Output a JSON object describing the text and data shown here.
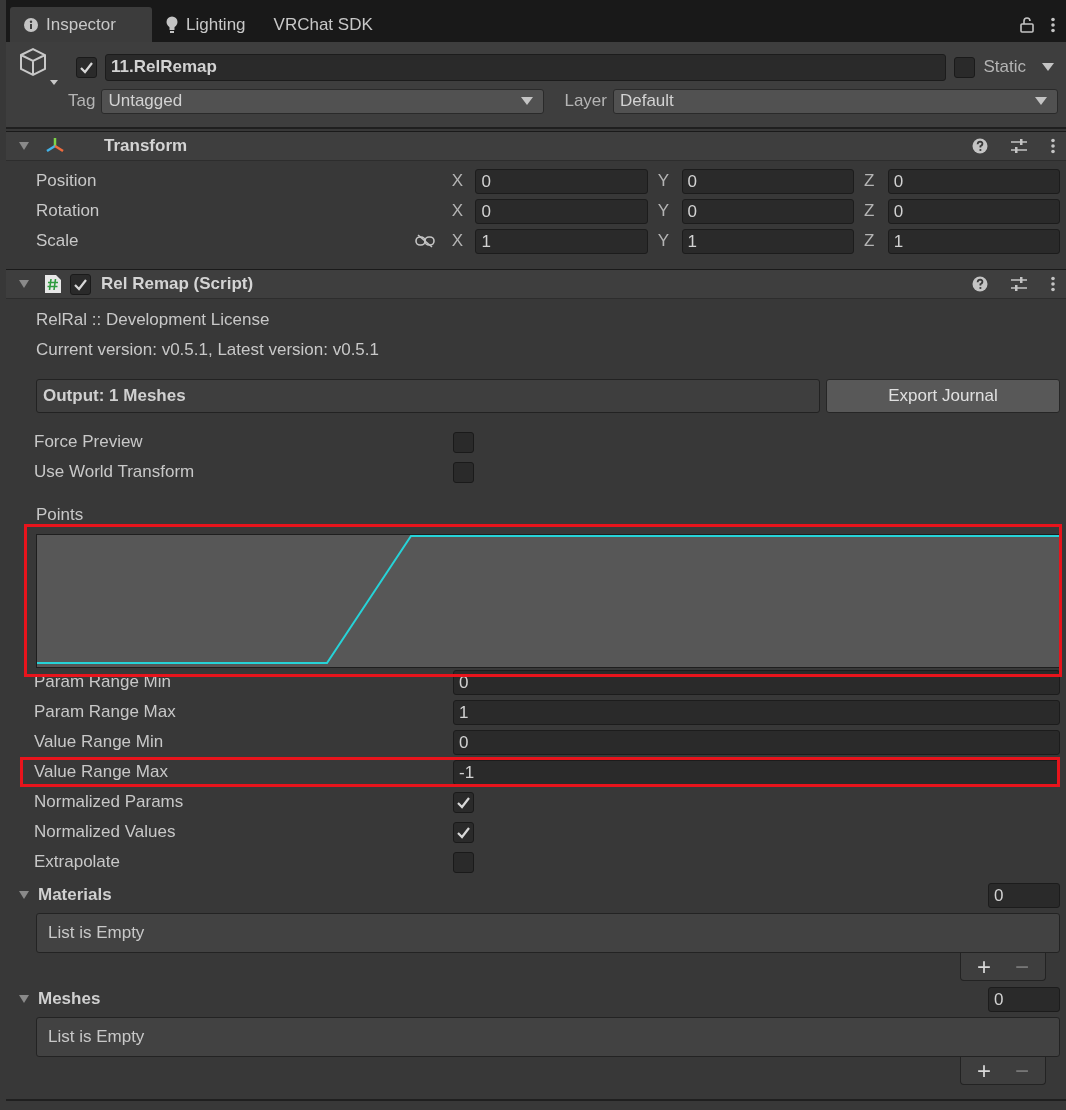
{
  "tabs": [
    {
      "label": "Inspector",
      "kind": "info",
      "selected": true
    },
    {
      "label": "Lighting",
      "kind": "bulb",
      "selected": false
    },
    {
      "label": "VRChat SDK",
      "kind": "plain",
      "selected": false
    }
  ],
  "object": {
    "active": true,
    "name": "11.RelRemap",
    "static": false,
    "static_label": "Static",
    "tag_label": "Tag",
    "tag": "Untagged",
    "layer_label": "Layer",
    "layer": "Default"
  },
  "transform": {
    "title": "Transform",
    "expanded": true,
    "rows": [
      {
        "label": "Position",
        "kind": "plain",
        "fields": [
          {
            "axis": "X",
            "value": "0"
          },
          {
            "axis": "Y",
            "value": "0"
          },
          {
            "axis": "Z",
            "value": "0"
          }
        ]
      },
      {
        "label": "Rotation",
        "kind": "plain",
        "fields": [
          {
            "axis": "X",
            "value": "0"
          },
          {
            "axis": "Y",
            "value": "0"
          },
          {
            "axis": "Z",
            "value": "0"
          }
        ]
      },
      {
        "label": "Scale",
        "kind": "scale",
        "fields": [
          {
            "axis": "X",
            "value": "1"
          },
          {
            "axis": "Y",
            "value": "1"
          },
          {
            "axis": "Z",
            "value": "1"
          }
        ]
      }
    ]
  },
  "script": {
    "title": "Rel Remap (Script)",
    "enabled": true,
    "expanded": true,
    "info": [
      "RelRal :: Development License",
      "Current version: v0.5.1, Latest version: v0.5.1"
    ],
    "output": "Output: 1 Meshes",
    "export_button": "Export Journal",
    "fields": [
      {
        "kind": "toggle",
        "label": "Force Preview",
        "checked": false,
        "highlighted": false
      },
      {
        "kind": "toggle",
        "label": "Use World Transform",
        "checked": false,
        "highlighted": false
      },
      {
        "kind": "curve",
        "label": "Points",
        "highlighted": true
      },
      {
        "kind": "number",
        "label": "Param Range Min",
        "value": "0",
        "highlighted": false
      },
      {
        "kind": "number",
        "label": "Param Range Max",
        "value": "1",
        "highlighted": false
      },
      {
        "kind": "number",
        "label": "Value Range Min",
        "value": "0",
        "highlighted": false
      },
      {
        "kind": "number",
        "label": "Value Range Max",
        "value": "-1",
        "highlighted": true
      },
      {
        "kind": "toggle",
        "label": "Normalized Params",
        "checked": true,
        "highlighted": false
      },
      {
        "kind": "toggle",
        "label": "Normalized Values",
        "checked": true,
        "highlighted": false
      },
      {
        "kind": "toggle",
        "label": "Extrapolate",
        "checked": false,
        "highlighted": false
      }
    ]
  },
  "lists": [
    {
      "title": "Materials",
      "expanded": true,
      "count": "0",
      "empty_text": "List is Empty",
      "add": "+",
      "remove": "−"
    },
    {
      "title": "Meshes",
      "expanded": true,
      "count": "0",
      "empty_text": "List is Empty",
      "add": "+",
      "remove": "−"
    }
  ]
}
